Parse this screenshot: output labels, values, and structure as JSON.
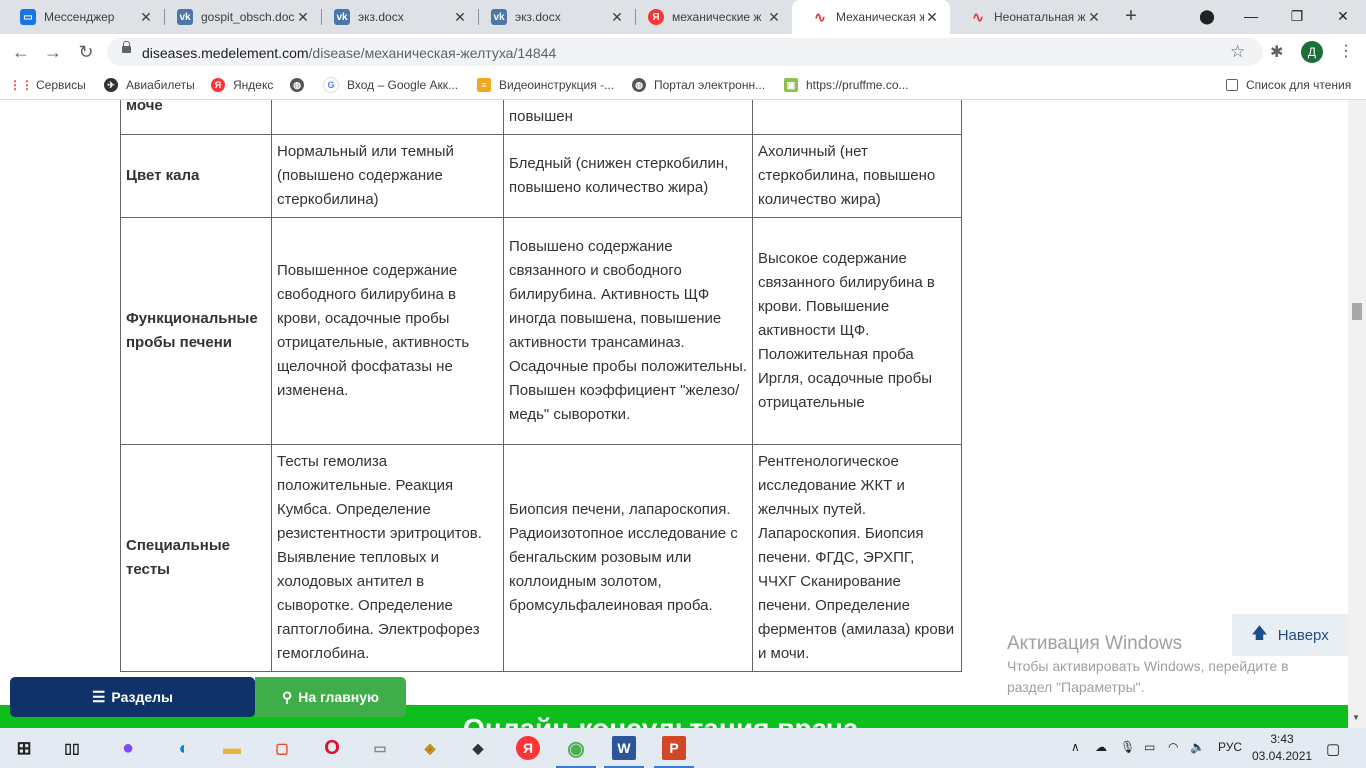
{
  "tabs": [
    {
      "title": "Мессенджер",
      "favicon": "messenger-icon",
      "color": "#1a73e8"
    },
    {
      "title": "gospit_obsch.doc",
      "favicon": "vk-icon",
      "color": "#4a76a8"
    },
    {
      "title": "экз.docx",
      "favicon": "vk-icon",
      "color": "#4a76a8"
    },
    {
      "title": "экз.docx",
      "favicon": "vk-icon",
      "color": "#4a76a8"
    },
    {
      "title": "механические ж",
      "favicon": "yandex-icon",
      "color": "#f33"
    },
    {
      "title": "Механическая ж",
      "favicon": "medelement-icon",
      "color": "#e53935",
      "active": true
    },
    {
      "title": "Неонатальная ж",
      "favicon": "medelement-icon",
      "color": "#e53935"
    }
  ],
  "address": {
    "domain": "diseases.medelement.com",
    "path": "/disease/механическая-желтуха/14844"
  },
  "avatar_letter": "Д",
  "bookmarks": [
    {
      "label": "Сервисы",
      "icon": "apps-grid-icon"
    },
    {
      "label": "Авиабилеты",
      "icon": "aviasales-icon"
    },
    {
      "label": "Яндекс",
      "icon": "yandex-icon"
    },
    {
      "label": "",
      "icon": "globe-icon"
    },
    {
      "label": "Вход – Google Акк...",
      "icon": "google-icon"
    },
    {
      "label": "Видеоинструкция -...",
      "icon": "stack-icon"
    },
    {
      "label": "Портал электронн...",
      "icon": "globe-icon"
    },
    {
      "label": "https://pruffme.co...",
      "icon": "pruffme-icon"
    }
  ],
  "reading_list": "Список для чтения",
  "table": {
    "rows": [
      {
        "head": "моче",
        "c1": "",
        "c2": "повышен",
        "c3": ""
      },
      {
        "head": "Цвет кала",
        "c1": "Нормальный или темный (повышено содержание стеркобилина)",
        "c2": "Бледный (снижен стеркобилин, повышено количество жира)",
        "c3": "Ахоличный (нет стеркобилина, повышено количество жира)"
      },
      {
        "head": "Функциональные пробы печени",
        "c1": "Повышенное содержание свободного билирубина в крови, осадочные пробы отрицательные, активность щелочной фосфатазы не изменена.",
        "c2": "Повышено содержание связанного и свободного билирубина. Активность ЩФ иногда повышена, повышение активности трансаминаз. Осадочные пробы положительны. Повышен коэффициент \"железо/медь\" сыворотки.",
        "c3": "Высокое содержание связанного билирубина в крови. Повышение активности ЩФ. Положительная проба Иргля, осадочные пробы отрицательные"
      },
      {
        "head": "Специальные тесты",
        "c1": "Тесты гемолиза положительные. Реакция Кумбса. Определение резистентности эритроцитов. Выявление тепловых и холодовых антител в сыворотке. Определение гаптоглобина. Электрофорез гемоглобина.",
        "c2": "Биопсия печени, лапароскопия. Радиоизотопное исследование с бенгальским розовым или коллоидным золотом, бромсульфалеиновая проба.",
        "c3": "Рентгенологическое исследование ЖКТ и желчных путей. Лапароскопия. Биопсия печени. ФГДС, ЭРХПГ, ЧЧХГ Сканирование печени. Определение ферментов (амилаза) крови и мочи."
      }
    ]
  },
  "buttons": {
    "sections": "Разделы",
    "home": "На главную",
    "to_top": "Наверх"
  },
  "banner_text": "Онлайн-консультация врача",
  "watermark": {
    "title": "Активация Windows",
    "text": "Чтобы активировать Windows, перейдите в раздел \"Параметры\"."
  },
  "taskbar": {
    "lang": "РУС",
    "time": "3:43",
    "date": "03.04.2021"
  },
  "colors": {
    "nav_blue": "#0f3368",
    "home_green": "#3fae49",
    "banner_green": "#0dbf1d"
  }
}
